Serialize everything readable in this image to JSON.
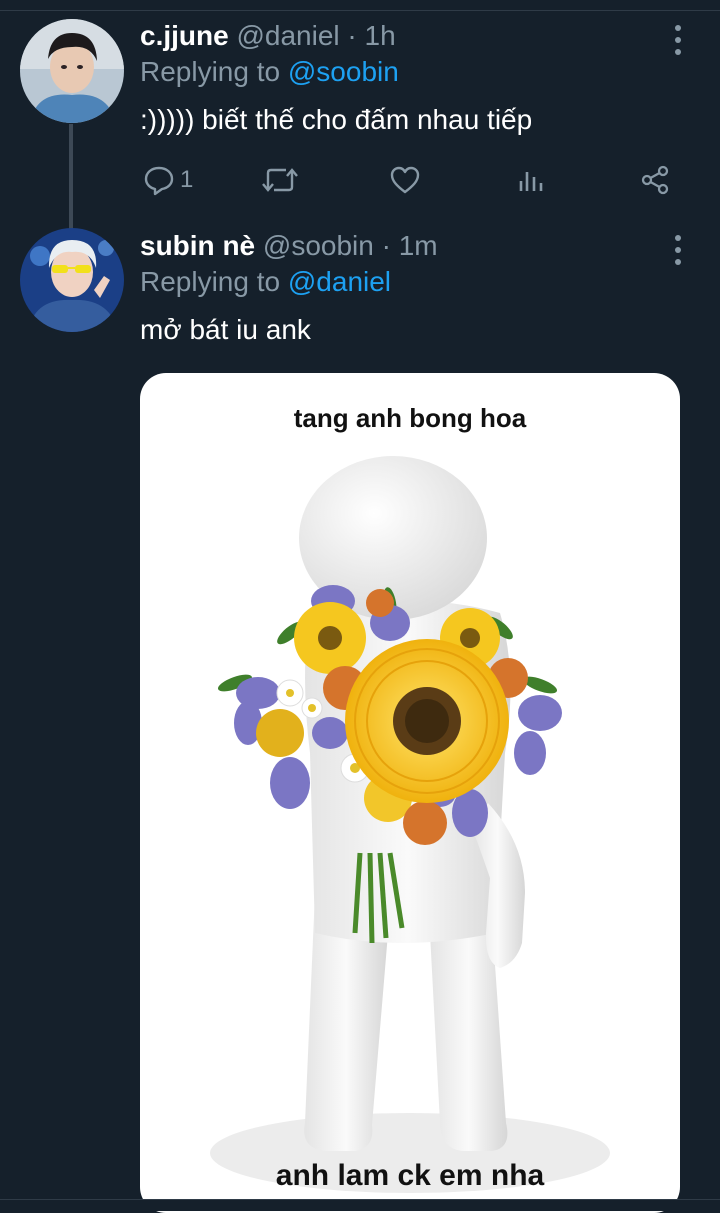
{
  "tweets": [
    {
      "name": "c.jjune",
      "handle": "@daniel",
      "separator": " · ",
      "time": "1h",
      "replying_prefix": "Replying to ",
      "replying_to": "@soobin",
      "text": ":))))) biết thế cho đấm nhau tiếp",
      "actions": {
        "reply_count": "1",
        "retweet_count": "",
        "like_count": ""
      }
    },
    {
      "name": "subin nè",
      "handle": "@soobin",
      "separator": " · ",
      "time": "1m",
      "replying_prefix": "Replying to ",
      "replying_to": "@daniel",
      "text": "mở bát iu ank",
      "media": {
        "caption_top": "tang anh bong hoa",
        "caption_bottom": "anh lam ck em nha"
      }
    }
  ],
  "colors": {
    "background": "#15202b",
    "secondary_text": "#8899a6",
    "mention": "#1da1f2"
  },
  "icons": [
    "more-icon",
    "reply-icon",
    "retweet-icon",
    "like-icon",
    "analytics-icon",
    "share-icon"
  ]
}
